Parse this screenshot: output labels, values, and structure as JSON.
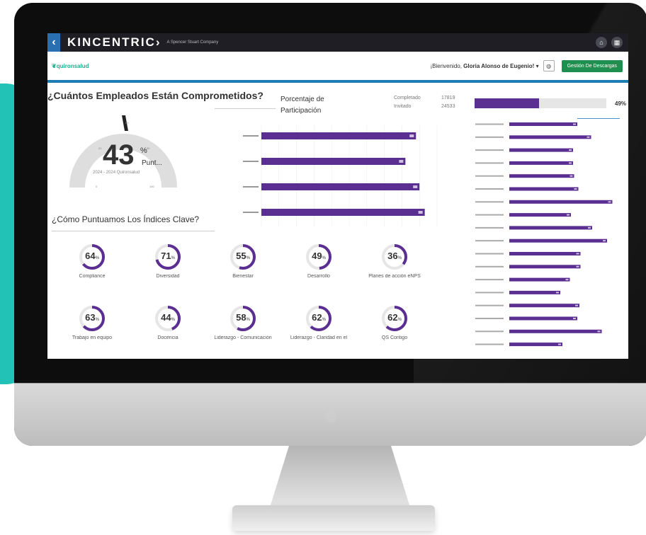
{
  "header": {
    "brand": "KINCENTRIC›",
    "brand_sub": "A Spencer Stuart Company",
    "chevron": "‹"
  },
  "subheader": {
    "logo": "quironsalud",
    "welcome_prefix": "¡Bienvenido, ",
    "welcome_name": "Gloria Alonso de Eugenio!",
    "welcome_caret": "▾",
    "download_button": "Gestión De Descargas"
  },
  "engagement": {
    "title": "¿Cuántos Empleados Están Comprometidos?",
    "score": "43",
    "score_unit": "%",
    "score_label": "Punt...",
    "period": "2024 - 2024 Quironsalud",
    "gauge_value": 0.43
  },
  "participation": {
    "title": "Porcentaje de Participación",
    "completed_label": "Completado",
    "completed_value": "17819",
    "invited_label": "Invitado",
    "invited_value": "24533",
    "percent_label": "49%",
    "percent": 49
  },
  "indices": {
    "title": "¿Cómo Puntuamos Los Índices Clave?",
    "items": [
      {
        "value": "64",
        "label": "Compliance",
        "pct": 64
      },
      {
        "value": "71",
        "label": "Diversidad",
        "pct": 71
      },
      {
        "value": "55",
        "label": "Bienestar",
        "pct": 55
      },
      {
        "value": "49",
        "label": "Desarrollo",
        "pct": 49
      },
      {
        "value": "36",
        "label": "Planes de acción eNPS",
        "pct": 36
      },
      {
        "value": "63",
        "label": "Trabajo en equipo",
        "pct": 63
      },
      {
        "value": "44",
        "label": "Docencia",
        "pct": 44
      },
      {
        "value": "58",
        "label": "Liderazgo - Comunicación",
        "pct": 58
      },
      {
        "value": "62",
        "label": "Liderazgo - Claridad en el",
        "pct": 62
      },
      {
        "value": "62",
        "label": "QS Contigo",
        "pct": 62
      }
    ],
    "unit": "%"
  },
  "colors": {
    "accent_purple": "#5b2e91",
    "download_green": "#1e8f4e",
    "top_bar": "#1e1e24",
    "teal": "#22c3b6"
  },
  "chart_data": [
    {
      "type": "bar",
      "orientation": "horizontal",
      "categories": [
        "",
        "",
        "",
        ""
      ],
      "values": [
        88,
        82,
        90,
        93
      ],
      "xlim": [
        0,
        100
      ],
      "grid": true
    },
    {
      "type": "bar",
      "orientation": "horizontal",
      "categories": [],
      "values": [
        64,
        77,
        60,
        60,
        61,
        65,
        97,
        58,
        78,
        92,
        67,
        67,
        57,
        48,
        66,
        64,
        87,
        50
      ],
      "xlim": [
        0,
        100
      ],
      "grid": false
    }
  ]
}
